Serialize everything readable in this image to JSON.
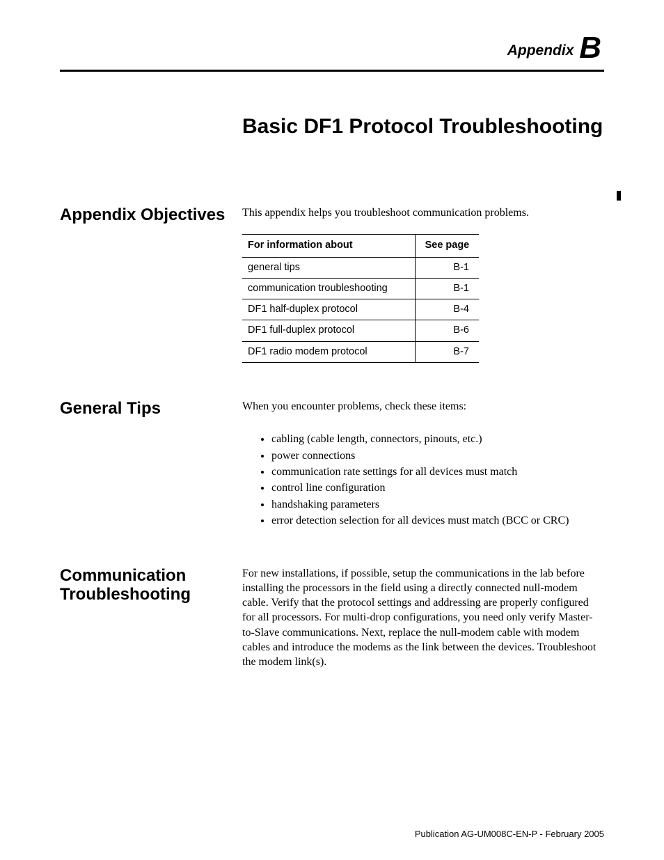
{
  "appendix": {
    "label_prefix": "Appendix",
    "letter": "B"
  },
  "title": "Basic DF1 Protocol Troubleshooting",
  "sections": {
    "objectives": {
      "heading": "Appendix Objectives",
      "intro": "This appendix helps you troubleshoot communication problems.",
      "table": {
        "headers": {
          "col1": "For information about",
          "col2": "See page"
        },
        "rows": [
          {
            "topic": "general tips",
            "page": "B-1"
          },
          {
            "topic": "communication troubleshooting",
            "page": "B-1"
          },
          {
            "topic": "DF1 half-duplex protocol",
            "page": "B-4"
          },
          {
            "topic": "DF1 full-duplex protocol",
            "page": "B-6"
          },
          {
            "topic": "DF1 radio modem protocol",
            "page": "B-7"
          }
        ]
      }
    },
    "general_tips": {
      "heading": "General Tips",
      "intro": "When you encounter problems, check these items:",
      "items": [
        "cabling (cable length, connectors, pinouts, etc.)",
        "power connections",
        "communication rate settings for all devices must match",
        "control line configuration",
        "handshaking parameters",
        "error detection selection for all devices must match (BCC or CRC)"
      ]
    },
    "comm_troubleshooting": {
      "heading": "Communication Troubleshooting",
      "body": "For new installations, if possible, setup the communications in the lab before installing the processors in the field using a directly connected null-modem cable. Verify that the protocol settings and addressing are properly configured for all processors. For multi-drop configurations, you need only verify Master-to-Slave communications. Next, replace the null-modem cable with modem cables and introduce the modems as the link between the devices. Troubleshoot the modem link(s)."
    }
  },
  "footer": "Publication AG-UM008C-EN-P - February 2005"
}
